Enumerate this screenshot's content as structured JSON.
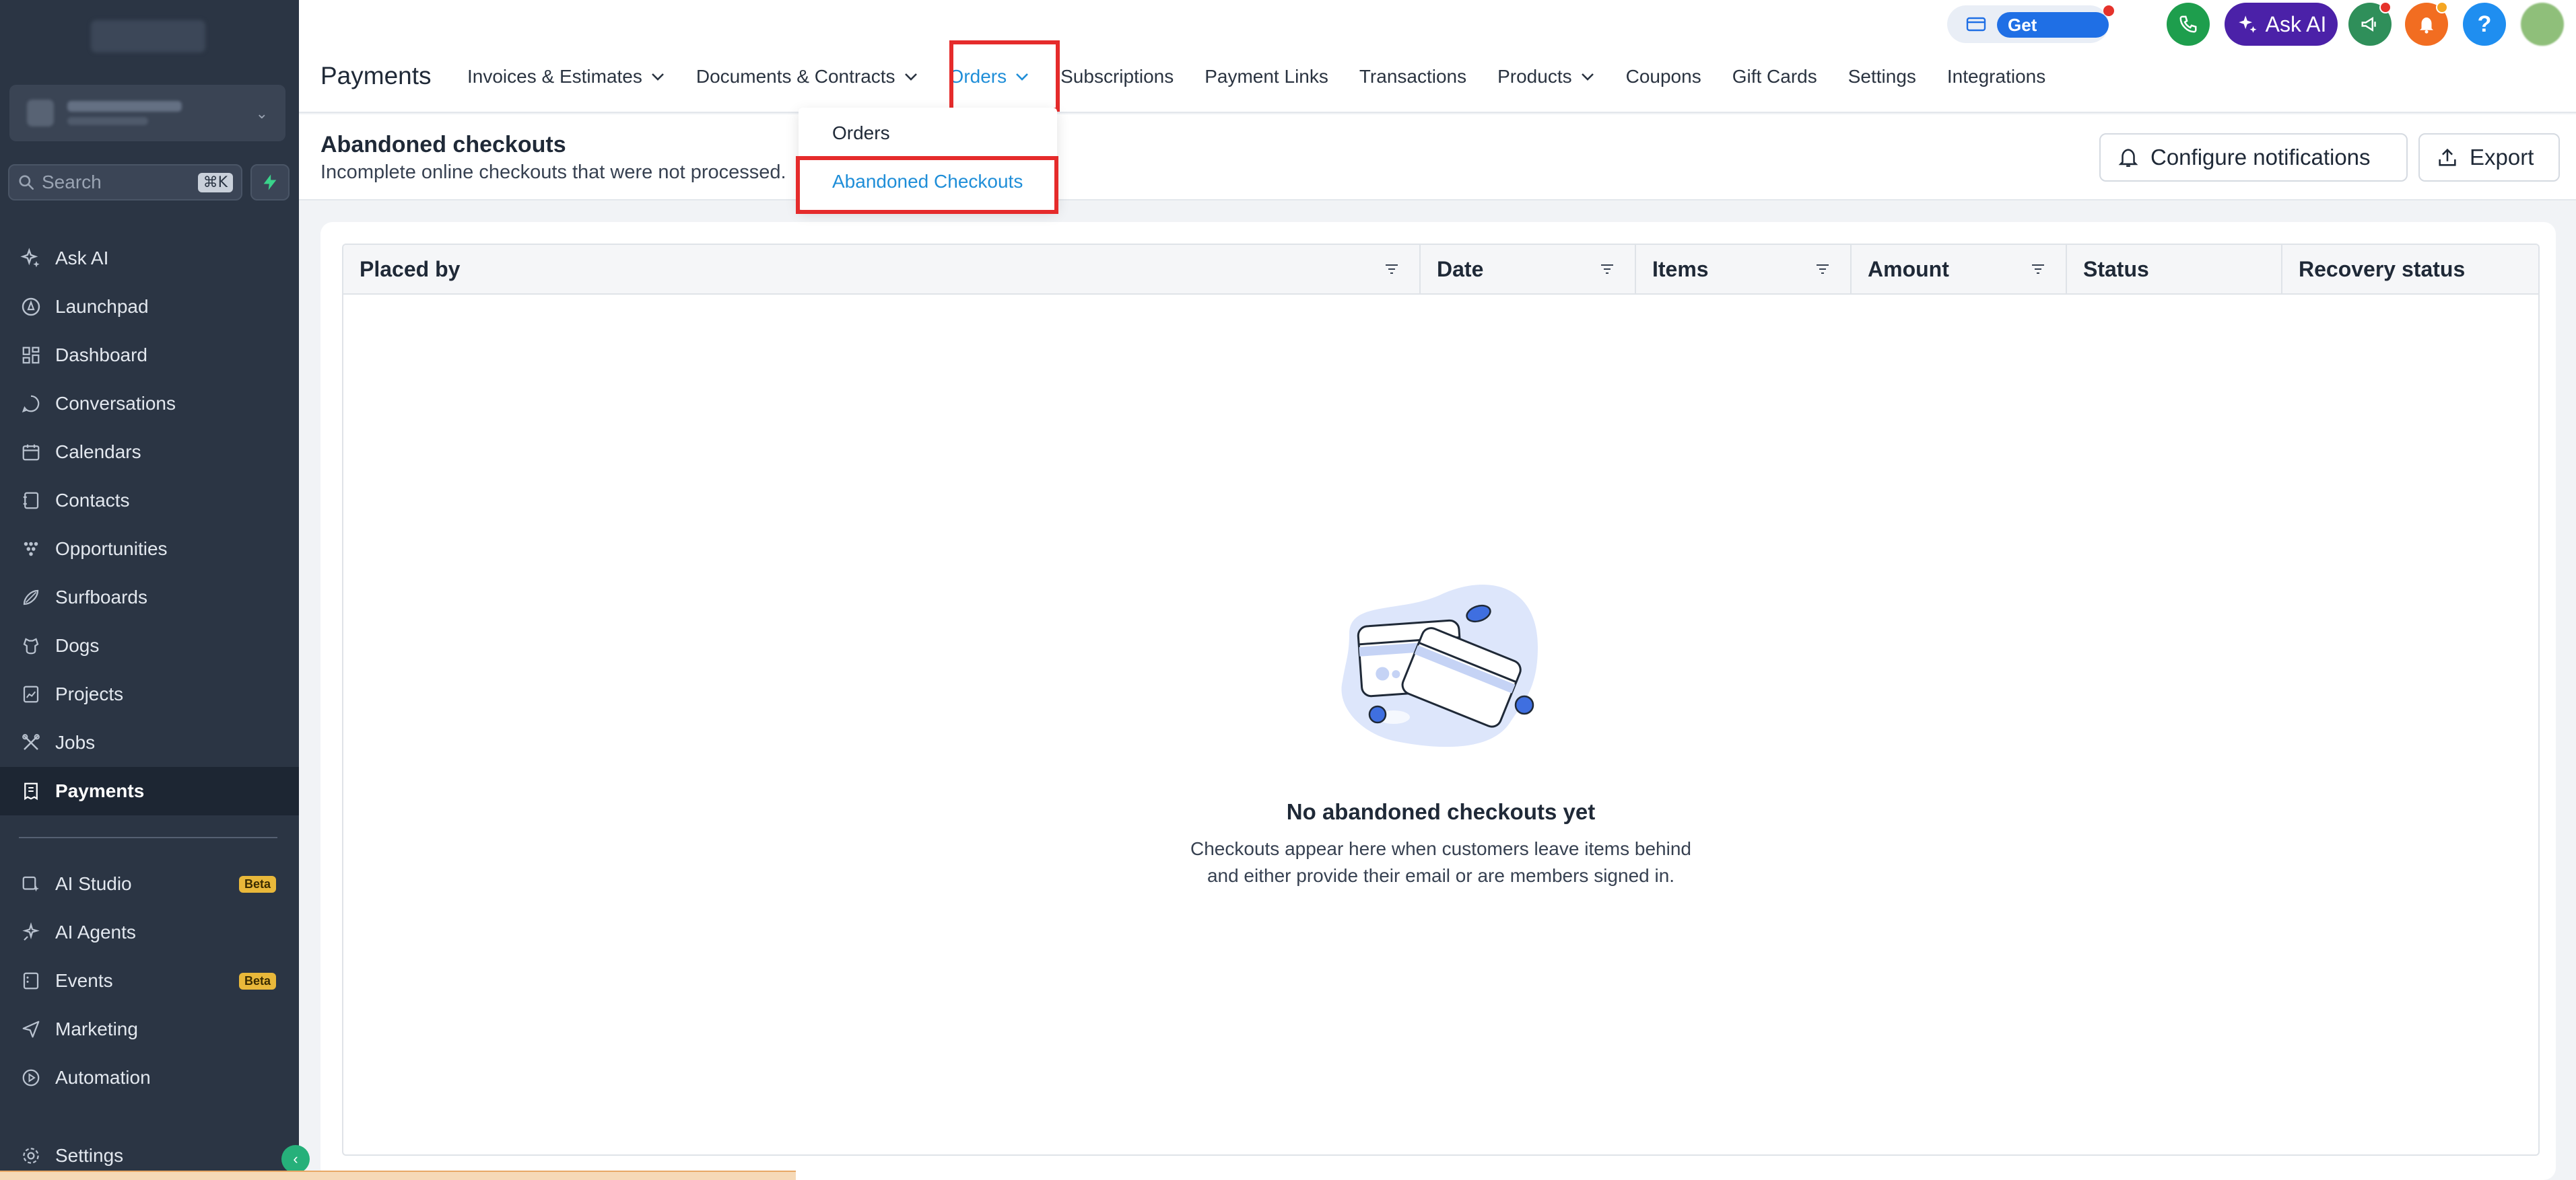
{
  "sidebar": {
    "search": {
      "placeholder": "Search",
      "shortcut": "⌘K"
    },
    "items": [
      {
        "label": "Ask AI",
        "icon": "sparkle-icon"
      },
      {
        "label": "Launchpad",
        "icon": "rocket-icon"
      },
      {
        "label": "Dashboard",
        "icon": "grid-icon"
      },
      {
        "label": "Conversations",
        "icon": "chat-icon"
      },
      {
        "label": "Calendars",
        "icon": "calendar-icon"
      },
      {
        "label": "Contacts",
        "icon": "contacts-icon"
      },
      {
        "label": "Opportunities",
        "icon": "funnel-icon"
      },
      {
        "label": "Surfboards",
        "icon": "surfboard-icon"
      },
      {
        "label": "Dogs",
        "icon": "dog-icon"
      },
      {
        "label": "Projects",
        "icon": "projects-icon"
      },
      {
        "label": "Jobs",
        "icon": "tools-icon"
      },
      {
        "label": "Payments",
        "icon": "receipt-icon",
        "active": true
      }
    ],
    "items2": [
      {
        "label": "AI Studio",
        "icon": "ai-studio-icon",
        "badge": "Beta"
      },
      {
        "label": "AI Agents",
        "icon": "ai-agents-icon"
      },
      {
        "label": "Events",
        "icon": "events-icon",
        "badge": "Beta"
      },
      {
        "label": "Marketing",
        "icon": "send-icon"
      },
      {
        "label": "Automation",
        "icon": "automation-icon"
      }
    ],
    "settings_label": "Settings"
  },
  "topbar": {
    "title": "Payments",
    "tabs": [
      {
        "label": "Invoices & Estimates",
        "dropdown": true
      },
      {
        "label": "Documents & Contracts",
        "dropdown": true
      },
      {
        "label": "Orders",
        "dropdown": true,
        "active": true
      },
      {
        "label": "Subscriptions"
      },
      {
        "label": "Payment Links"
      },
      {
        "label": "Transactions"
      },
      {
        "label": "Products",
        "dropdown": true
      },
      {
        "label": "Coupons"
      },
      {
        "label": "Gift Cards"
      },
      {
        "label": "Settings"
      },
      {
        "label": "Integrations"
      }
    ],
    "get_started": "Get Started",
    "ask_ai": "Ask AI",
    "help": "?"
  },
  "dropdown": {
    "items": [
      "Orders",
      "Abandoned Checkouts"
    ]
  },
  "subheader": {
    "title": "Abandoned checkouts",
    "description": "Incomplete online checkouts that were not processed.",
    "configure_label": "Configure notifications",
    "export_label": "Export"
  },
  "table": {
    "columns": [
      "Placed by",
      "Date",
      "Items",
      "Amount",
      "Status",
      "Recovery status"
    ]
  },
  "empty": {
    "title": "No abandoned checkouts yet",
    "line1": "Checkouts appear here when customers leave items behind",
    "line2": "and either provide their email or are members signed in."
  },
  "colors": {
    "sidebar_bg": "#2b3544",
    "accent": "#1f8ed8",
    "highlight": "#e52b2b"
  }
}
